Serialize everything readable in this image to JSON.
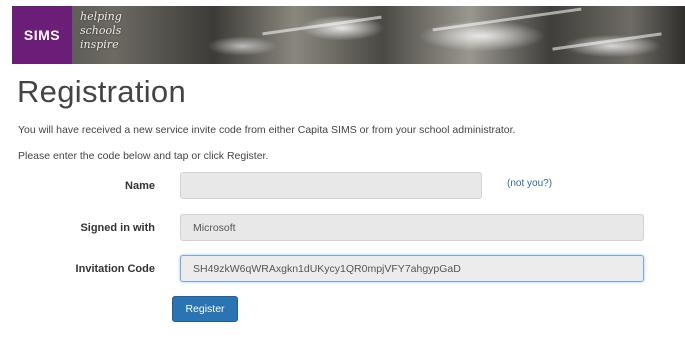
{
  "banner": {
    "logo": "SIMS",
    "tagline": [
      "helping",
      "schools",
      "inspire"
    ]
  },
  "page": {
    "title": "Registration",
    "info_line_1": "You will have received a new service invite code from either Capita SIMS or from your school administrator.",
    "info_line_2": "Please enter the code below and tap or click Register."
  },
  "form": {
    "name": {
      "label": "Name",
      "value": "",
      "link": "(not you?)"
    },
    "signed_in": {
      "label": "Signed in with",
      "value": "Microsoft"
    },
    "invitation": {
      "label": "Invitation Code",
      "value": "SH49zkW6qWRAxgkn1dUKycy1QR0mpjVFY7ahgypGaD"
    },
    "register_label": "Register"
  },
  "colors": {
    "logo_bg": "#6b1e78",
    "button_bg": "#2a74b3",
    "link": "#2c6aa8"
  }
}
